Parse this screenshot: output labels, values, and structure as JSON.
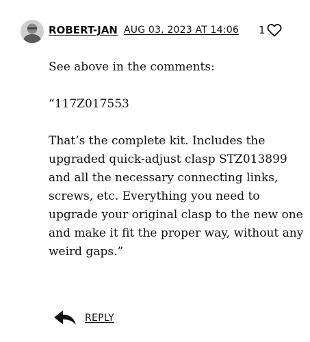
{
  "comment": {
    "author": "ROBERT-JAN",
    "date": "AUG 03, 2023 AT 14:06",
    "like_count": "1",
    "like_icon": "heart-outline-icon",
    "paragraphs": [
      [
        "See above in the comments:"
      ],
      [
        "“117Z017553"
      ],
      [
        "That’s the complete kit. Includes the",
        "upgraded quick-adjust clasp STZ013899",
        "and all the necessary connecting links,",
        "screws, etc. Everything you need to",
        "upgrade your original clasp to the new one",
        "and make it fit the proper way, without any",
        "weird gaps.”"
      ]
    ],
    "reply_label": "REPLY",
    "reply_icon": "reply-arrow-icon"
  }
}
